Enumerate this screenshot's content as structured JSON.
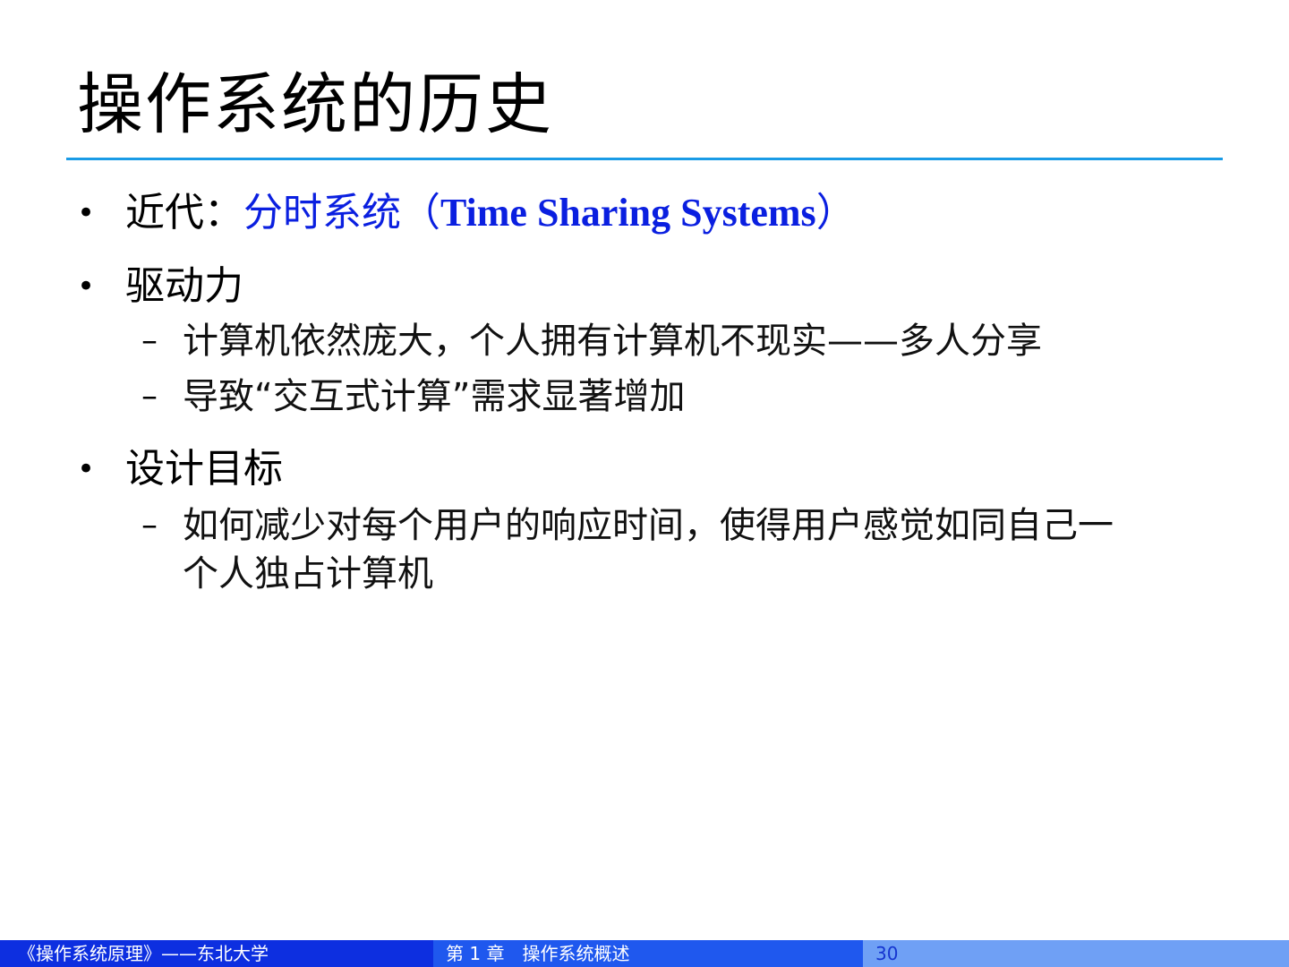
{
  "slide": {
    "title": "操作系统的历史",
    "items": [
      {
        "bullet": "•",
        "label": "近代：",
        "highlight_cn": "分时系统（",
        "highlight_en": "Time Sharing Systems",
        "highlight_close": "）"
      },
      {
        "bullet": "•",
        "label": "驱动力",
        "subitems": [
          {
            "dash": "–",
            "text": "计算机依然庞大，个人拥有计算机不现实——多人分享"
          },
          {
            "dash": "–",
            "text": "导致“交互式计算”需求显著增加"
          }
        ]
      },
      {
        "bullet": "•",
        "label": "设计目标",
        "subitems": [
          {
            "dash": "–",
            "text_line1": "如何减少对每个用户的响应时间，使得用户感觉如同自己一",
            "text_line2": "个人独占计算机"
          }
        ]
      }
    ]
  },
  "footer": {
    "course": "《操作系统原理》——东北大学",
    "chapter": "第 1 章　操作系统概述",
    "page": "30"
  },
  "colors": {
    "rule": "#1a9be6",
    "highlight": "#0a1fe0",
    "footer_left": "#0d2fe0",
    "footer_mid": "#1f58ee",
    "footer_right": "#6fa0f5"
  }
}
